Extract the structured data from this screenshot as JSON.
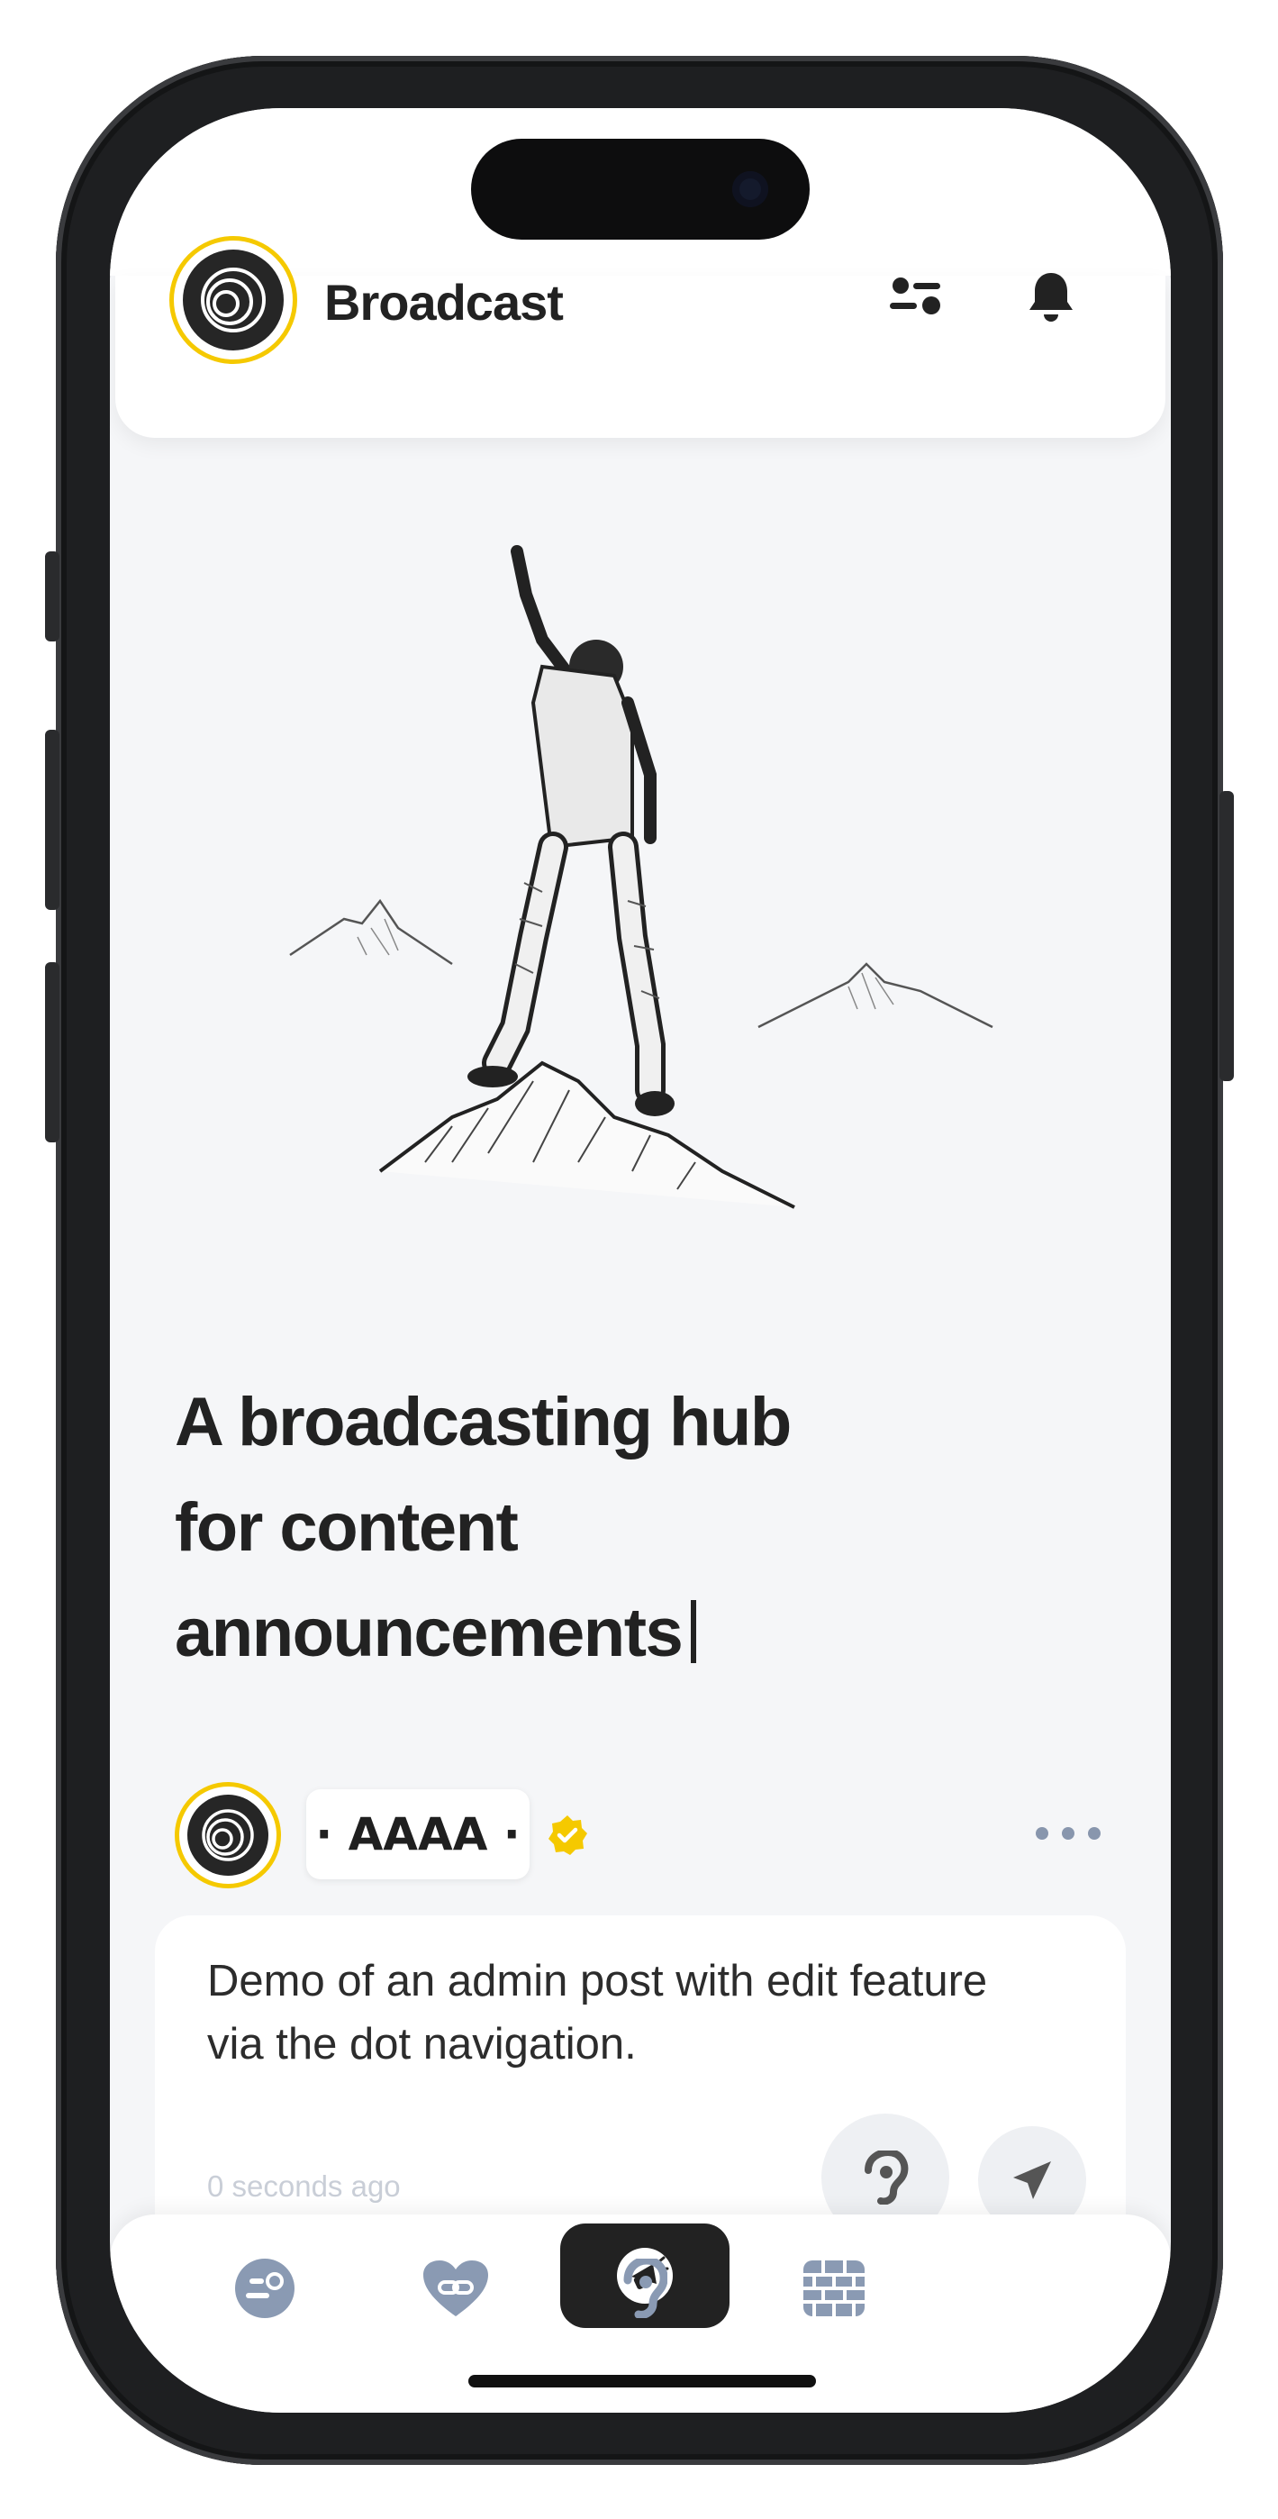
{
  "header": {
    "brand_name": "Broadcast",
    "filter_icon": "sliders-icon",
    "notification_icon": "bell-icon"
  },
  "hero": {
    "image_icon": "person-on-mountain-illustration",
    "headline_line1": "A broadcasting hub",
    "headline_line2": "for content",
    "headline_line3": "announcements"
  },
  "post": {
    "author": "· AAAA ·",
    "verified_icon": "verified-badge-icon",
    "more_icon": "ellipsis-icon",
    "body": "Demo of an admin post with edit feature via the dot navigation.",
    "timestamp": "0 seconds ago",
    "listen_icon": "ear-icon",
    "send_icon": "paper-plane-icon"
  },
  "bottom_nav": {
    "items": [
      {
        "icon": "profile-toggle-icon",
        "active": false
      },
      {
        "icon": "heart-link-icon",
        "active": false
      },
      {
        "icon": "megaphone-icon",
        "active": true
      },
      {
        "icon": "ear-icon",
        "active": false
      },
      {
        "icon": "brick-wall-icon",
        "active": false
      }
    ]
  },
  "colors": {
    "accent_yellow": "#f5c900",
    "dark": "#222222",
    "nav_icon": "#8a9ab3",
    "background": "#f5f6f8"
  }
}
